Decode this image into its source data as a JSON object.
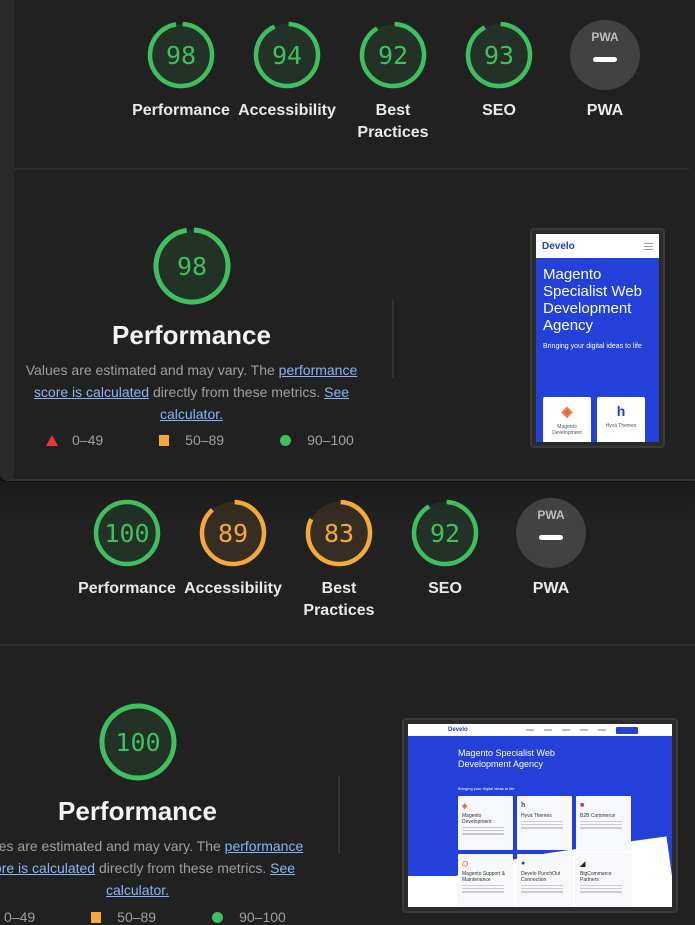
{
  "colors": {
    "pass": "#3fc05e",
    "average": "#f5a93a",
    "fail": "#e53935",
    "pwa_bg": "#424242",
    "link": "#8ab4f8"
  },
  "reports": [
    {
      "categories": [
        {
          "label": "Performance",
          "score": 98,
          "rating": "pass"
        },
        {
          "label": "Accessibility",
          "score": 94,
          "rating": "pass"
        },
        {
          "label": "Best Practices",
          "score": 92,
          "rating": "pass"
        },
        {
          "label": "SEO",
          "score": 93,
          "rating": "pass"
        },
        {
          "label": "PWA",
          "score": null,
          "rating": "na",
          "badge_text": "PWA"
        }
      ],
      "performance": {
        "score": 98,
        "title": "Performance",
        "desc_prefix": "Values are estimated and may vary. The ",
        "link1": "performance score is calculated",
        "desc_mid": " directly from these metrics. ",
        "link2": "See calculator."
      },
      "screenshot": {
        "type": "mobile",
        "logo": "Develo",
        "hero": "Magento Specialist Web Development Agency",
        "sub": "Bringing your digital ideas to life",
        "cards": [
          {
            "icon": "magento-icon",
            "glyph": "◈",
            "label": "Magento Development"
          },
          {
            "icon": "hyva-icon",
            "glyph": "h",
            "label": "Hyvä Themes"
          }
        ]
      }
    },
    {
      "categories": [
        {
          "label": "Performance",
          "score": 100,
          "rating": "pass"
        },
        {
          "label": "Accessibility",
          "score": 89,
          "rating": "average"
        },
        {
          "label": "Best Practices",
          "score": 83,
          "rating": "average"
        },
        {
          "label": "SEO",
          "score": 92,
          "rating": "pass"
        },
        {
          "label": "PWA",
          "score": null,
          "rating": "na",
          "badge_text": "PWA"
        }
      ],
      "performance": {
        "score": 100,
        "title": "Performance",
        "desc_prefix": "Values are estimated and may vary. The ",
        "link1": "performance score is calculated",
        "desc_mid": " directly from these metrics. ",
        "link2": "See calculator."
      },
      "screenshot": {
        "type": "desktop",
        "logo": "Develo",
        "hero": "Magento Specialist Web Development Agency",
        "sub": "Bringing your digital ideas to life",
        "cards": [
          {
            "icon": "magento-icon",
            "glyph": "◈",
            "label": "Magento Development"
          },
          {
            "icon": "hyva-icon",
            "glyph": "h",
            "label": "Hyvä Themes"
          },
          {
            "icon": "b2b-icon",
            "glyph": "■",
            "label": "B2B Commerce"
          },
          {
            "icon": "support-icon",
            "glyph": "⬡",
            "label": "Magento Support & Maintenance"
          },
          {
            "icon": "punchout-icon",
            "glyph": "●",
            "label": "Develo PunchOut Connection"
          },
          {
            "icon": "bigcommerce-icon",
            "glyph": "◢",
            "label": "BigCommerce Partners"
          }
        ]
      }
    }
  ],
  "legend": [
    {
      "shape": "triangle",
      "range": "0–49"
    },
    {
      "shape": "square",
      "range": "50–89"
    },
    {
      "shape": "circle",
      "range": "90–100"
    }
  ]
}
